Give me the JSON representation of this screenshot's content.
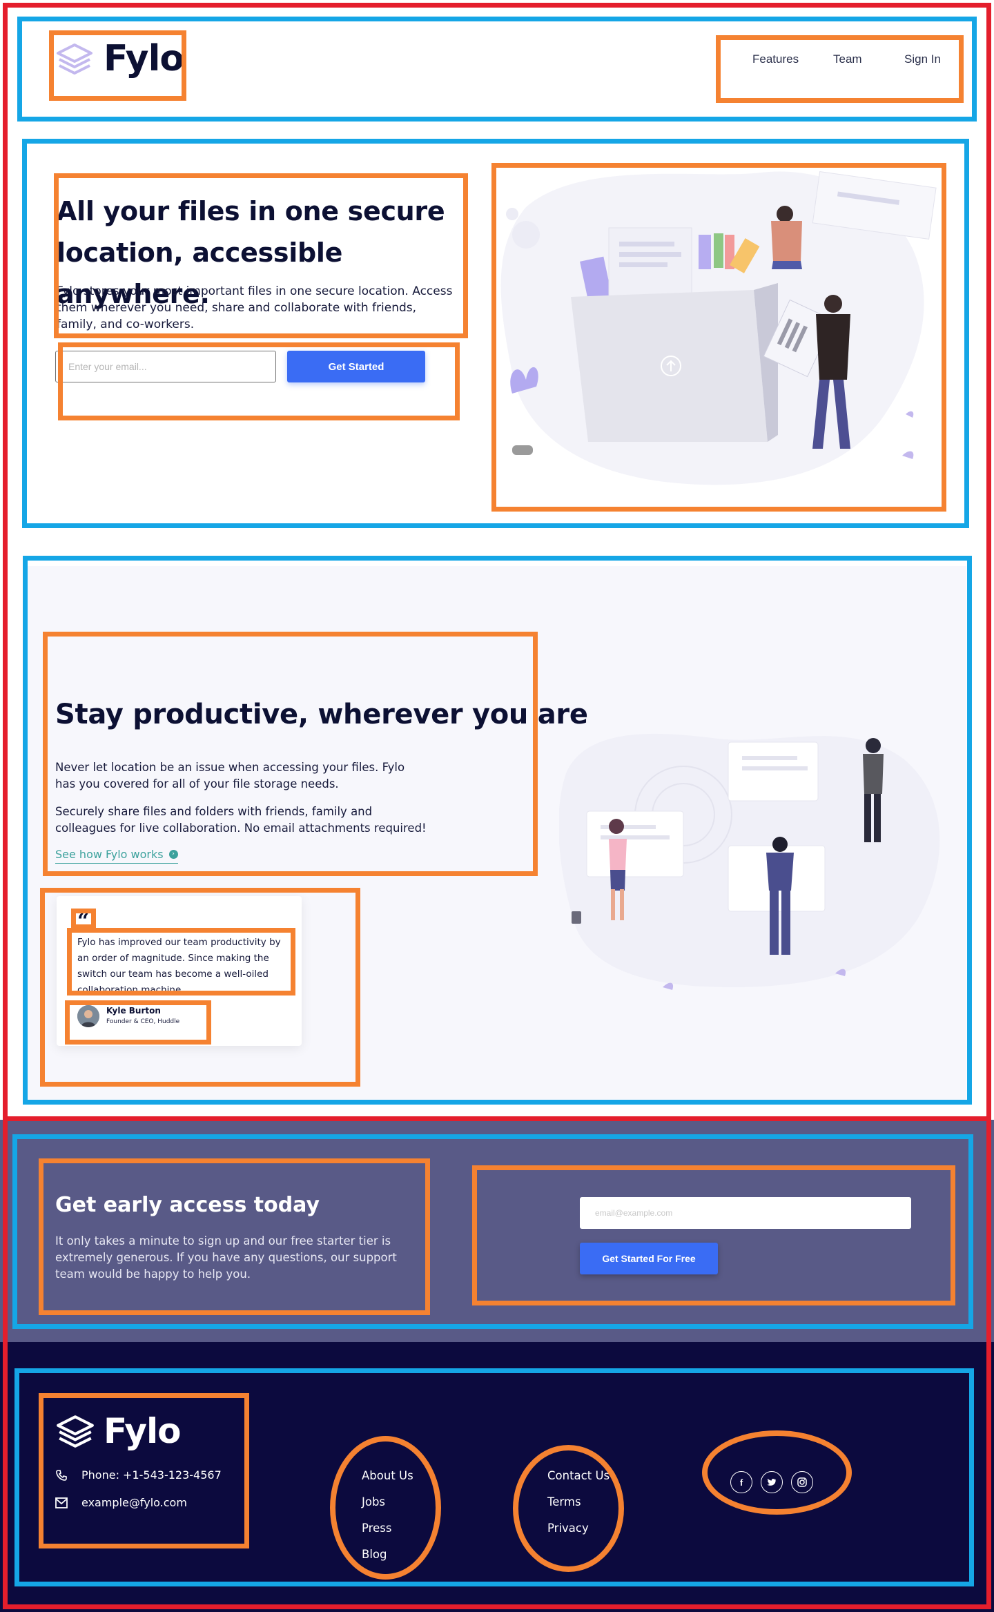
{
  "header": {
    "brand": "Fylo",
    "nav": [
      "Features",
      "Team",
      "Sign In"
    ]
  },
  "hero": {
    "title": "All your files in one secure location, accessible anywhere.",
    "text": "Fylo stores your most important files in one secure location. Access them wherever you need, share and collaborate with friends, family, and co-workers.",
    "email_placeholder": "Enter your email...",
    "cta": "Get Started",
    "illustration": "intro-illustration"
  },
  "productive": {
    "title": "Stay productive, wherever you are",
    "p1": "Never let location be an issue when accessing your files. Fylo has you covered for all of your file storage needs.",
    "p2": "Securely share files and folders with friends, family and colleagues for live collaboration. No email attachments required!",
    "link": "See how Fylo works",
    "illustration": "stay-productive-illustration"
  },
  "testimonial": {
    "quote_icon": "quote-icon",
    "quote": "Fylo has improved our team productivity by an order of magnitude. Since making the switch our team has become a well-oiled collaboration machine.",
    "name": "Kyle Burton",
    "role": "Founder & CEO, Huddle"
  },
  "early_access": {
    "title": "Get early access today",
    "text": "It only takes a minute to sign up and our free starter tier is extremely generous. If you have any questions, our support team would be happy to help you.",
    "email_placeholder": "email@example.com",
    "cta": "Get Started For Free"
  },
  "footer": {
    "brand": "Fylo",
    "phone": "Phone: +1-543-123-4567",
    "email": "example@fylo.com",
    "col1": [
      "About Us",
      "Jobs",
      "Press",
      "Blog"
    ],
    "col2": [
      "Contact Us",
      "Terms",
      "Privacy"
    ],
    "socials": [
      "facebook-icon",
      "twitter-icon",
      "instagram-icon"
    ]
  },
  "colors": {
    "primary": "#3a6cf4",
    "dark_navy": "#0c0a3e",
    "cta_bg": "#595a87",
    "link_teal": "#3ba19c",
    "annotation_red": "#e41e2c",
    "annotation_blue": "#15a6e6",
    "annotation_orange": "#f58231"
  }
}
